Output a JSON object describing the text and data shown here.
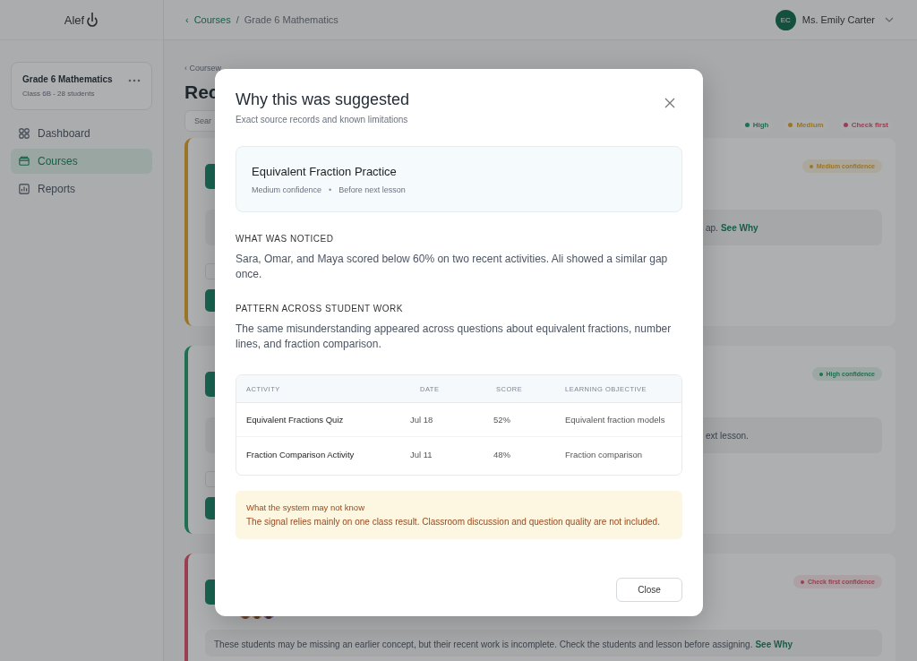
{
  "header": {
    "logo": "Alef",
    "breadcrumb": {
      "back": "‹",
      "parent": "Courses",
      "separator": "/",
      "current": "Grade 6 Mathematics"
    },
    "user": {
      "initials": "EC",
      "name": "Ms. Emily Carter"
    }
  },
  "sidebar": {
    "class_card": {
      "title": "Grade 6 Mathematics",
      "subtitle": "Class 6B - 28 students"
    },
    "items": [
      {
        "label": "Dashboard",
        "selected": false
      },
      {
        "label": "Courses",
        "selected": true
      },
      {
        "label": "Reports",
        "selected": false
      }
    ]
  },
  "main": {
    "back_link": "‹ Coursew",
    "title": "Rec",
    "search": {
      "placeholder": "Sear"
    },
    "legend": [
      {
        "label": "High",
        "kind": "high"
      },
      {
        "label": "Medium",
        "kind": "medium"
      },
      {
        "label": "Check first",
        "kind": "check"
      }
    ],
    "cards": [
      {
        "kind": "action",
        "badge": {
          "kind": "medium",
          "label": "Medium confidence"
        },
        "note": "ap.",
        "link": "See Why"
      },
      {
        "kind": "action",
        "badge": {
          "kind": "high",
          "label": "High confidence"
        },
        "note": "ext lesson."
      },
      {
        "kind": "students",
        "badge": {
          "kind": "check",
          "label": "Check first confidence"
        },
        "note": "These students may be missing an earlier concept, but their recent work is incomplete. Check the students and lesson before assigning.",
        "link": "See Why"
      }
    ]
  },
  "modal": {
    "title": "Why this was suggested",
    "subtitle": "Exact source records and known limitations",
    "suggestion": {
      "title": "Equivalent Fraction Practice",
      "confidence": "Medium confidence",
      "separator": "•",
      "timing": "Before next lesson"
    },
    "sections": [
      {
        "heading": "WHAT WAS NOTICED",
        "text": "Sara, Omar, and Maya scored below 60% on two recent activities. Ali showed a similar gap once."
      },
      {
        "heading": "PATTERN ACROSS STUDENT WORK",
        "text": "The same misunderstanding appeared across questions about equivalent fractions, number lines, and fraction comparison."
      }
    ],
    "table": {
      "columns": [
        "ACTIVITY",
        "DATE",
        "SCORE",
        "LEARNING OBJECTIVE"
      ],
      "rows": [
        [
          "Equivalent Fractions Quiz",
          "Jul 18",
          "52%",
          "Equivalent fraction models"
        ],
        [
          "Fraction Comparison Activity",
          "Jul 11",
          "48%",
          "Fraction comparison"
        ]
      ]
    },
    "limitation": {
      "title": "What the system may not know",
      "text": "The signal relies mainly on one class result. Classroom discussion and question quality are not included."
    },
    "close_button": "Close"
  }
}
